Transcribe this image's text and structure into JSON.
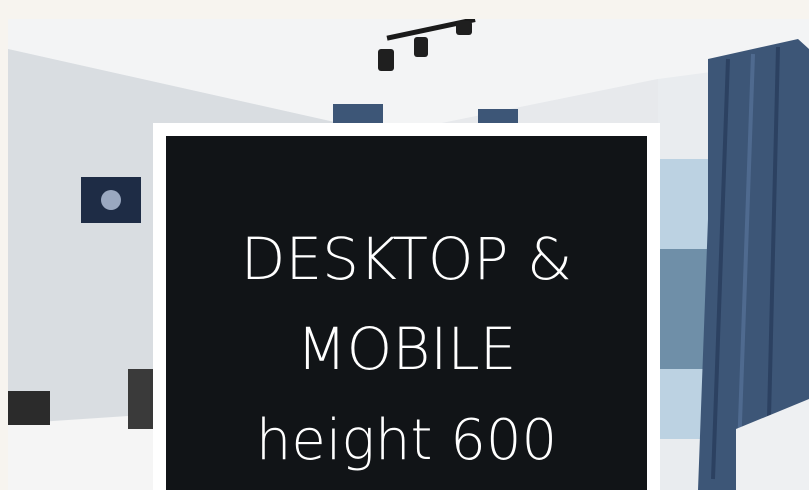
{
  "banner": {
    "background_photo": "bedroom-interior-photo",
    "heading": "DESKTOP & MOBILE",
    "subheading": "height 600"
  },
  "colors": {
    "page_background": "#f7f4ef",
    "card_border": "#ffffff",
    "card_background": "#111417",
    "text": "#ffffff",
    "curtain": "#3d5677"
  }
}
